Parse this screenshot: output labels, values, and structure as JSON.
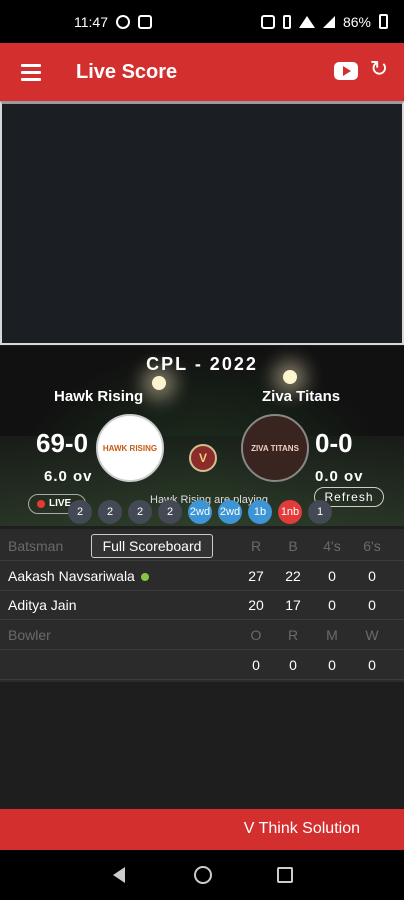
{
  "status_bar": {
    "time": "11:47",
    "battery": "86%"
  },
  "app_bar": {
    "title": "Live Score",
    "icons": [
      "menu-icon",
      "youtube-icon",
      "refresh-icon"
    ]
  },
  "match": {
    "league": "CPL - 2022",
    "team1": {
      "name": "Hawk Rising",
      "score": "69-0",
      "overs": "6.0 ov",
      "logo_text": "HAWK RISING"
    },
    "team2": {
      "name": "Ziva Titans",
      "score": "0-0",
      "overs": "0.0 ov",
      "logo_text": "ZIVA TITANS"
    },
    "vs_label": "V",
    "live_label": "LIVE",
    "refresh_label": "Refresh",
    "status_text": "Hawk Rising are playing"
  },
  "balls": [
    "2",
    "2",
    "2",
    "2",
    "2wd",
    "2wd",
    "1b",
    "1nb",
    "1"
  ],
  "batting": {
    "header": {
      "label": "Batsman",
      "full_scoreboard": "Full Scoreboard",
      "r": "R",
      "b": "B",
      "fours": "4's",
      "sixes": "6's"
    },
    "rows": [
      {
        "name": "Aakash Navsariwala",
        "r": "27",
        "b": "22",
        "fours": "0",
        "sixes": "0"
      },
      {
        "name": "Aditya Jain",
        "r": "20",
        "b": "17",
        "fours": "0",
        "sixes": "0"
      }
    ]
  },
  "bowling": {
    "header": {
      "label": "Bowler",
      "o": "O",
      "r": "R",
      "m": "M",
      "w": "W"
    },
    "rows": [
      {
        "name": "",
        "o": "0",
        "r": "0",
        "m": "0",
        "w": "0"
      }
    ]
  },
  "footer": {
    "text": "V Think Solution"
  },
  "colors": {
    "accent": "#d32f2f",
    "active_dot": "#8bc34a",
    "ball_extra": "#3d95d6",
    "ball_noball": "#e23b3b"
  }
}
